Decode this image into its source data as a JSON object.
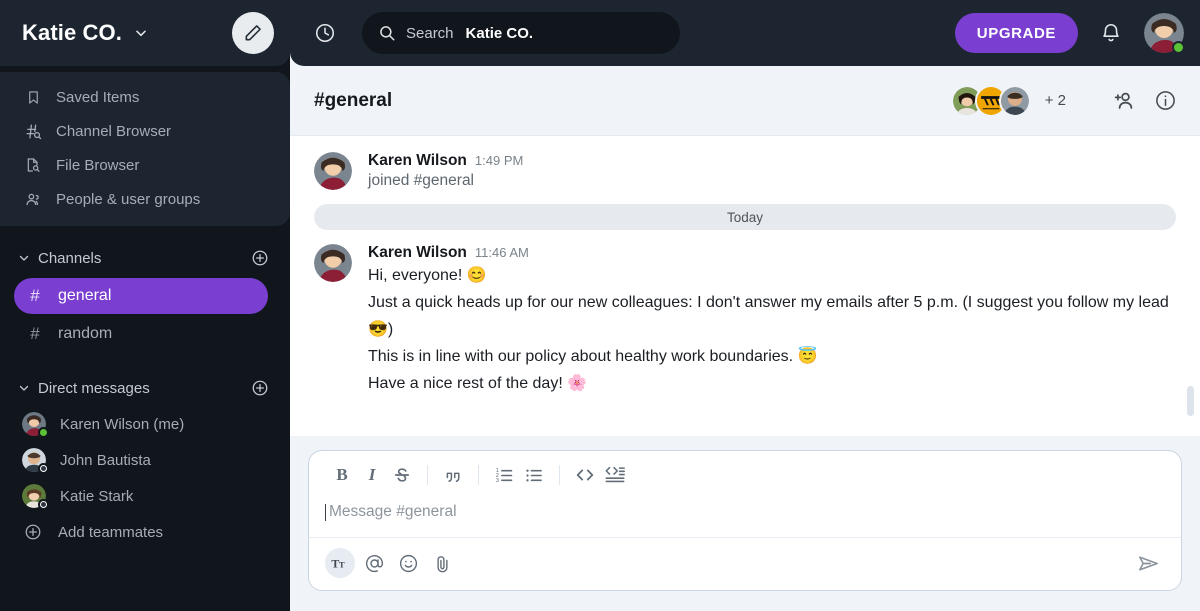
{
  "workspace": {
    "name": "Katie CO.",
    "caret_icon": "chevron-down-icon",
    "compose_icon": "pencil-icon"
  },
  "sidebar": {
    "nav_items": [
      {
        "label": "Saved Items",
        "icon": "bookmark-icon"
      },
      {
        "label": "Channel Browser",
        "icon": "channel-search-icon"
      },
      {
        "label": "File Browser",
        "icon": "file-search-icon"
      },
      {
        "label": "People & user groups",
        "icon": "people-icon"
      }
    ],
    "channels_section": {
      "title": "Channels",
      "add_icon": "plus-circle-icon",
      "caret_icon": "chevron-down-icon",
      "items": [
        {
          "name": "general",
          "hash": "#",
          "active": true
        },
        {
          "name": "random",
          "hash": "#",
          "active": false
        }
      ]
    },
    "dm_section": {
      "title": "Direct messages",
      "add_icon": "plus-circle-icon",
      "caret_icon": "chevron-down-icon",
      "items": [
        {
          "name": "Karen Wilson (me)",
          "status": "online"
        },
        {
          "name": "John Bautista",
          "status": "away"
        },
        {
          "name": "Katie Stark",
          "status": "away"
        }
      ],
      "add_teammates": {
        "label": "Add teammates",
        "icon": "plus-circle-icon"
      }
    }
  },
  "topbar": {
    "history_icon": "clock-icon",
    "search": {
      "icon": "search-icon",
      "label": "Search",
      "workspace": "Katie CO.",
      "placeholder": "Search Katie CO."
    },
    "upgrade_label": "UPGRADE",
    "notifications_icon": "bell-icon",
    "avatar_name": "avatar",
    "avatar_status": "online"
  },
  "channel_header": {
    "name": "#general",
    "member_overflow": "+ 2",
    "add_member_icon": "add-person-icon",
    "info_icon": "info-icon",
    "members_shown": 3
  },
  "messages": [
    {
      "author": "Karen Wilson",
      "time": "1:49 PM",
      "system_text": "joined #general",
      "lines": []
    }
  ],
  "date_divider": "Today",
  "main_message": {
    "author": "Karen Wilson",
    "time": "11:46 AM",
    "lines": [
      "Hi, everyone! 😊",
      "Just a quick heads up for our new colleagues: I don't answer my emails after 5 p.m. (I suggest you follow my lead 😎)",
      "This is in line with our policy about healthy work boundaries. 😇",
      "Have a nice rest of the day! 🌸"
    ]
  },
  "composer": {
    "placeholder": "Message #general",
    "format_buttons": [
      {
        "name": "bold",
        "label": "B",
        "icon": "bold-icon"
      },
      {
        "name": "italic",
        "label": "I",
        "icon": "italic-icon"
      },
      {
        "name": "strikethrough",
        "label": "S",
        "icon": "strikethrough-icon"
      },
      {
        "name": "blockquote",
        "label": "",
        "icon": "quote-icon"
      },
      {
        "name": "ordered-list",
        "label": "",
        "icon": "ordered-list-icon"
      },
      {
        "name": "bulleted-list",
        "label": "",
        "icon": "bulleted-list-icon"
      },
      {
        "name": "inline-code",
        "label": "",
        "icon": "code-icon"
      },
      {
        "name": "code-block",
        "label": "",
        "icon": "code-block-icon"
      }
    ],
    "action_buttons": [
      {
        "name": "formatting",
        "icon": "text-format-icon",
        "selected": true
      },
      {
        "name": "mention",
        "icon": "at-icon",
        "selected": false
      },
      {
        "name": "emoji",
        "icon": "smiley-icon",
        "selected": false
      },
      {
        "name": "attach",
        "icon": "paperclip-icon",
        "selected": false
      }
    ],
    "send_icon": "send-icon"
  },
  "colors": {
    "sidebar_bg": "#10161c",
    "sidebar_panel": "#1d2630",
    "accent_purple": "#7a3fd1",
    "message_bg": "#ffffff",
    "chrome_bg": "#f0f4f8",
    "online_green": "#5bc236"
  }
}
